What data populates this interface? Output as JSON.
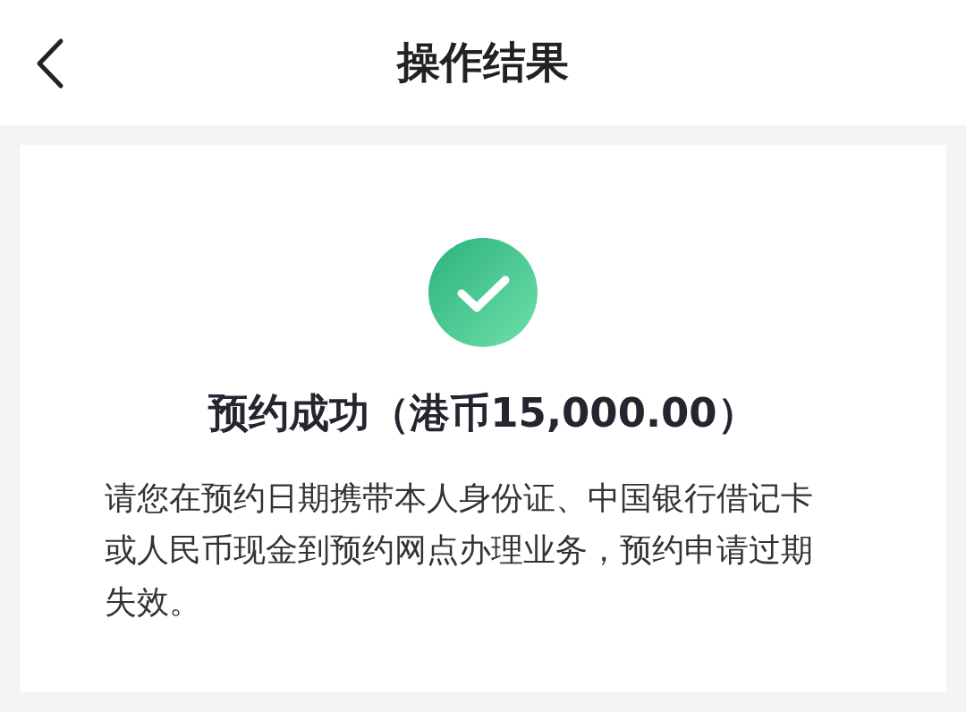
{
  "header": {
    "title": "操作结果"
  },
  "result": {
    "success": true,
    "heading": "预约成功（港币15,000.00）",
    "message": "请您在预约日期携带本人身份证、中国银行借记卡或人民币现金到预约网点办理业务，预约申请过期失效。"
  }
}
